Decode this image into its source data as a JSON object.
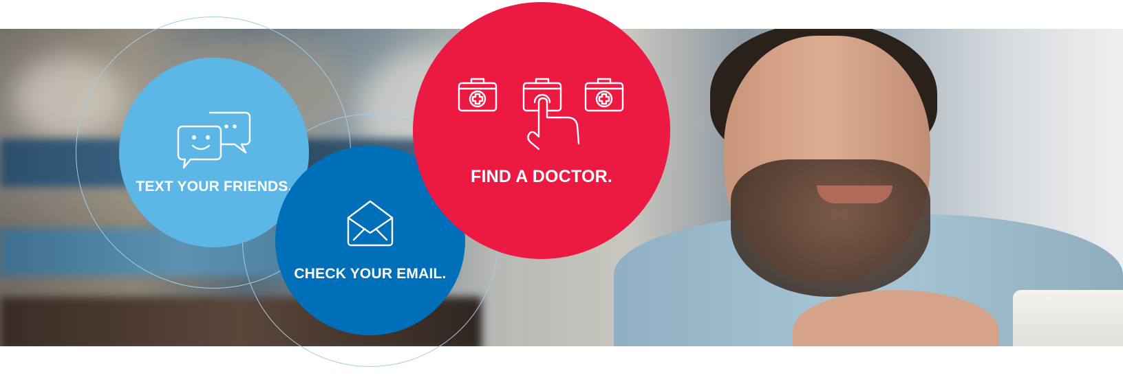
{
  "colors": {
    "text_bubble": "#5cb6e6",
    "email_bubble": "#006fba",
    "doctor_bubble": "#ec1943",
    "ring": "#9ecfe8",
    "label": "#ffffff"
  },
  "bubbles": {
    "text_friends": {
      "label": "TEXT YOUR FRIENDS.",
      "icon": "chat-bubbles-icon"
    },
    "check_email": {
      "label": "CHECK YOUR EMAIL.",
      "icon": "envelope-icon"
    },
    "find_doctor": {
      "label": "FIND A DOCTOR.",
      "icon": "medical-kit-tap-icon"
    }
  },
  "background": {
    "icon": "photo-smiling-man"
  }
}
